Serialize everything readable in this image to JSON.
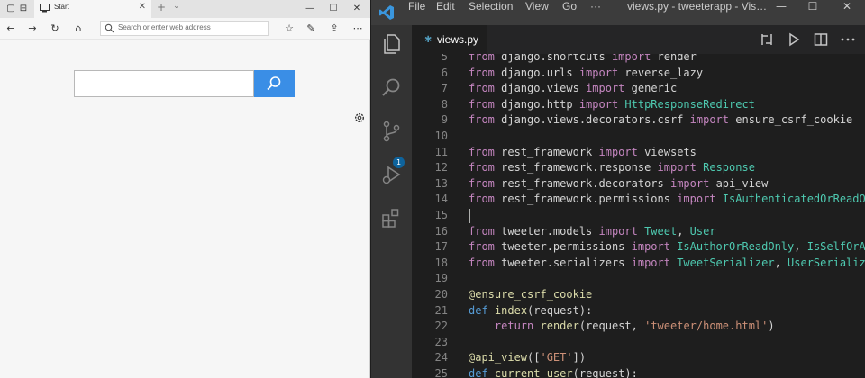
{
  "browser": {
    "tab_title": "Start",
    "tab_close": "✕",
    "new_tab": "+",
    "tab_dropdown": "⌄",
    "win_min": "—",
    "win_max": "☐",
    "win_close": "✕",
    "address_placeholder": "Search or enter web address",
    "icons": {
      "tab_favicon": "browser-start-icon",
      "back": "back-arrow-icon",
      "forward": "forward-arrow-icon",
      "refresh": "refresh-icon",
      "home": "home-icon",
      "favorites": "star-icon",
      "pen": "pen-icon",
      "share": "share-icon",
      "settings": "gear-icon",
      "search": "search-icon"
    },
    "colors": {
      "search_button": "#3a8ee6"
    }
  },
  "vscode": {
    "menu": [
      "File",
      "Edit",
      "Selection",
      "View",
      "Go",
      "···"
    ],
    "title": "views.py - tweeterapp - Vis…",
    "win_min": "—",
    "win_max": "☐",
    "win_close": "✕",
    "tab_label": "views.py",
    "scm_badge": "1",
    "icons": {
      "explorer": "files-icon",
      "search": "search-icon",
      "scm": "source-control-icon",
      "debug": "run-debug-icon",
      "extensions": "extensions-icon",
      "compare": "compare-changes-icon",
      "run": "run-icon",
      "split": "split-editor-icon",
      "more": "more-actions-icon"
    },
    "colors": {
      "accent": "#0e639c",
      "editor_bg": "#1e1e1e",
      "activity_bg": "#333333",
      "titlebar_bg": "#3c3c3c"
    },
    "code_lines": [
      {
        "n": "5",
        "parts": [
          [
            "kw",
            "from"
          ],
          [
            "mod",
            " django.shortcuts "
          ],
          [
            "kw",
            "import"
          ],
          [
            "mod",
            " render"
          ]
        ]
      },
      {
        "n": "6",
        "parts": [
          [
            "kw",
            "from"
          ],
          [
            "mod",
            " django.urls "
          ],
          [
            "kw",
            "import"
          ],
          [
            "mod",
            " reverse_lazy"
          ]
        ]
      },
      {
        "n": "7",
        "parts": [
          [
            "kw",
            "from"
          ],
          [
            "mod",
            " django.views "
          ],
          [
            "kw",
            "import"
          ],
          [
            "mod",
            " generic"
          ]
        ]
      },
      {
        "n": "8",
        "parts": [
          [
            "kw",
            "from"
          ],
          [
            "mod",
            " django.http "
          ],
          [
            "kw",
            "import"
          ],
          [
            "cls",
            " HttpResponseRedirect"
          ]
        ]
      },
      {
        "n": "9",
        "parts": [
          [
            "kw",
            "from"
          ],
          [
            "mod",
            " django.views.decorators.csrf "
          ],
          [
            "kw",
            "import"
          ],
          [
            "mod",
            " ensure_csrf_cookie"
          ]
        ]
      },
      {
        "n": "10",
        "parts": []
      },
      {
        "n": "11",
        "parts": [
          [
            "kw",
            "from"
          ],
          [
            "mod",
            " rest_framework "
          ],
          [
            "kw",
            "import"
          ],
          [
            "mod",
            " viewsets"
          ]
        ]
      },
      {
        "n": "12",
        "parts": [
          [
            "kw",
            "from"
          ],
          [
            "mod",
            " rest_framework.response "
          ],
          [
            "kw",
            "import"
          ],
          [
            "cls",
            " Response"
          ]
        ]
      },
      {
        "n": "13",
        "parts": [
          [
            "kw",
            "from"
          ],
          [
            "mod",
            " rest_framework.decorators "
          ],
          [
            "kw",
            "import"
          ],
          [
            "mod",
            " api_view"
          ]
        ]
      },
      {
        "n": "14",
        "parts": [
          [
            "kw",
            "from"
          ],
          [
            "mod",
            " rest_framework.permissions "
          ],
          [
            "kw",
            "import"
          ],
          [
            "cls",
            " IsAuthenticatedOrReadOn"
          ]
        ]
      },
      {
        "n": "15",
        "parts": []
      },
      {
        "n": "16",
        "parts": [
          [
            "kw",
            "from"
          ],
          [
            "mod",
            " tweeter.models "
          ],
          [
            "kw",
            "import"
          ],
          [
            "cls",
            " Tweet"
          ],
          [
            "mod",
            ", "
          ],
          [
            "cls",
            "User"
          ]
        ]
      },
      {
        "n": "17",
        "parts": [
          [
            "kw",
            "from"
          ],
          [
            "mod",
            " tweeter.permissions "
          ],
          [
            "kw",
            "import"
          ],
          [
            "cls",
            " IsAuthorOrReadOnly"
          ],
          [
            "mod",
            ", "
          ],
          [
            "cls",
            "IsSelfOrAc"
          ]
        ]
      },
      {
        "n": "18",
        "parts": [
          [
            "kw",
            "from"
          ],
          [
            "mod",
            " tweeter.serializers "
          ],
          [
            "kw",
            "import"
          ],
          [
            "cls",
            " TweetSerializer"
          ],
          [
            "mod",
            ", "
          ],
          [
            "cls",
            "UserSerialize"
          ]
        ]
      },
      {
        "n": "19",
        "parts": []
      },
      {
        "n": "20",
        "parts": [
          [
            "dec",
            "@ensure_csrf_cookie"
          ]
        ]
      },
      {
        "n": "21",
        "parts": [
          [
            "def",
            "def"
          ],
          [
            "mod",
            " "
          ],
          [
            "fn",
            "index"
          ],
          [
            "mod",
            "(request):"
          ]
        ]
      },
      {
        "n": "22",
        "parts": [
          [
            "mod",
            "    "
          ],
          [
            "kw",
            "return"
          ],
          [
            "mod",
            " "
          ],
          [
            "fn",
            "render"
          ],
          [
            "mod",
            "(request, "
          ],
          [
            "str",
            "'tweeter/home.html'"
          ],
          [
            "mod",
            ")"
          ]
        ]
      },
      {
        "n": "23",
        "parts": []
      },
      {
        "n": "24",
        "parts": [
          [
            "dec",
            "@api_view"
          ],
          [
            "mod",
            "(["
          ],
          [
            "str",
            "'GET'"
          ],
          [
            "mod",
            "])"
          ]
        ]
      },
      {
        "n": "25",
        "parts": [
          [
            "def",
            "def"
          ],
          [
            "mod",
            " "
          ],
          [
            "fn",
            "current_user"
          ],
          [
            "mod",
            "(request):"
          ]
        ]
      }
    ]
  }
}
